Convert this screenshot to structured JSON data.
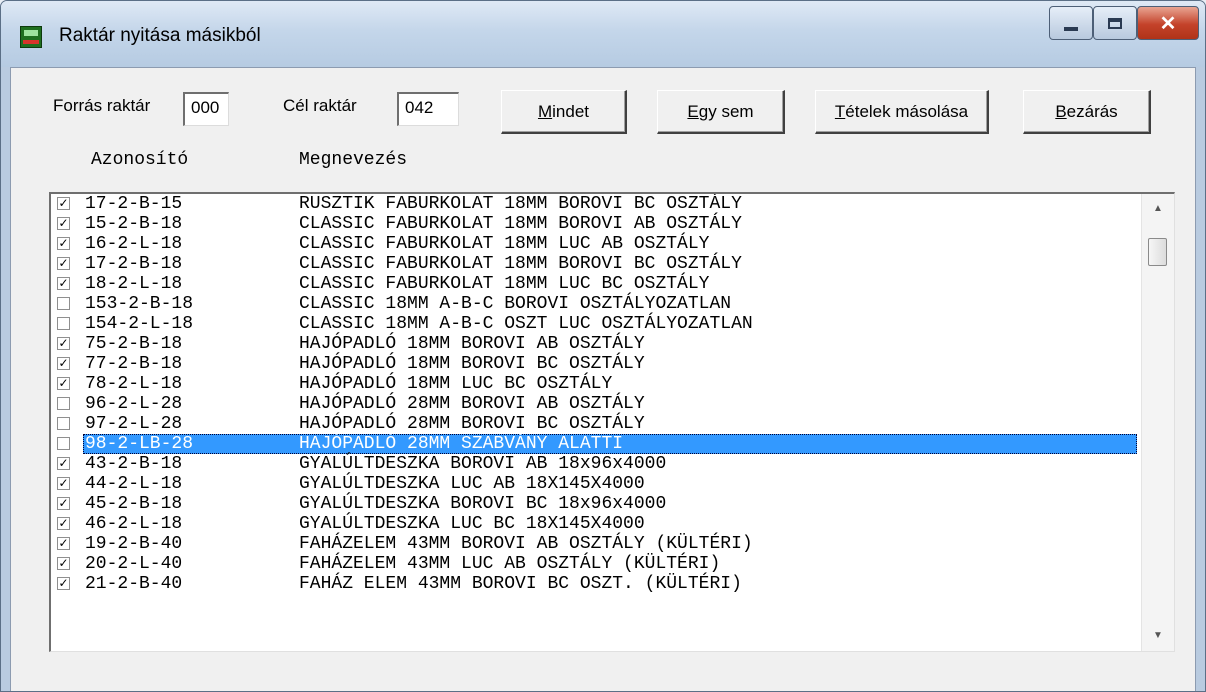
{
  "window": {
    "title": "Raktár nyitása másikból"
  },
  "form": {
    "source_label": "Forrás raktár",
    "source_value": "000",
    "target_label": "Cél raktár",
    "target_value": "042"
  },
  "buttons": {
    "all": {
      "mnemonic": "M",
      "rest": "indet"
    },
    "none": {
      "mnemonic": "E",
      "rest": "gy sem"
    },
    "copy": {
      "mnemonic": "T",
      "rest": "ételek másolása"
    },
    "close": {
      "mnemonic": "B",
      "rest": "ezárás"
    }
  },
  "columns": {
    "id": "Azonosító",
    "name": "Megnevezés"
  },
  "items": [
    {
      "checked": true,
      "id": "17-2-B-15",
      "name": "RUSZTIK FABURKOLAT 18MM BOROVI BC OSZTÁLY"
    },
    {
      "checked": true,
      "id": "15-2-B-18",
      "name": "CLASSIC FABURKOLAT 18MM BOROVI AB OSZTÁLY"
    },
    {
      "checked": true,
      "id": "16-2-L-18",
      "name": "CLASSIC FABURKOLAT 18MM LUC AB OSZTÁLY"
    },
    {
      "checked": true,
      "id": "17-2-B-18",
      "name": "CLASSIC FABURKOLAT 18MM BOROVI BC OSZTÁLY"
    },
    {
      "checked": true,
      "id": "18-2-L-18",
      "name": "CLASSIC FABURKOLAT 18MM LUC BC OSZTÁLY"
    },
    {
      "checked": false,
      "id": "153-2-B-18",
      "name": "CLASSIC 18MM A-B-C BOROVI OSZTÁLYOZATLAN"
    },
    {
      "checked": false,
      "id": "154-2-L-18",
      "name": "CLASSIC 18MM A-B-C OSZT LUC OSZTÁLYOZATLAN"
    },
    {
      "checked": true,
      "id": "75-2-B-18",
      "name": "HAJÓPADLÓ 18MM BOROVI AB OSZTÁLY"
    },
    {
      "checked": true,
      "id": "77-2-B-18",
      "name": "HAJÓPADLÓ 18MM BOROVI BC OSZTÁLY"
    },
    {
      "checked": true,
      "id": "78-2-L-18",
      "name": "HAJÓPADLÓ 18MM LUC BC OSZTÁLY"
    },
    {
      "checked": false,
      "id": "96-2-L-28",
      "name": "HAJÓPADLÓ 28MM BOROVI AB OSZTÁLY"
    },
    {
      "checked": false,
      "id": "97-2-L-28",
      "name": "HAJÓPADLÓ 28MM BOROVI BC OSZTÁLY"
    },
    {
      "checked": false,
      "id": "98-2-LB-28",
      "name": "HAJÓPADLÓ 28MM  SZABVÁNY ALATTI",
      "selected": true
    },
    {
      "checked": true,
      "id": "43-2-B-18",
      "name": "GYALÚLTDESZKA  BOROVI AB 18x96x4000"
    },
    {
      "checked": true,
      "id": "44-2-L-18",
      "name": "GYALÚLTDESZKA  LUC AB 18X145X4000"
    },
    {
      "checked": true,
      "id": "45-2-B-18",
      "name": "GYALÚLTDESZKA  BOROVI BC 18x96x4000"
    },
    {
      "checked": true,
      "id": "46-2-L-18",
      "name": "GYALÚLTDESZKA  LUC BC 18X145X4000"
    },
    {
      "checked": true,
      "id": "19-2-B-40",
      "name": "FAHÁZELEM 43MM BOROVI AB OSZTÁLY (KÜLTÉRI)"
    },
    {
      "checked": true,
      "id": "20-2-L-40",
      "name": "FAHÁZELEM 43MM LUC AB OSZTÁLY (KÜLTÉRI)"
    },
    {
      "checked": true,
      "id": "21-2-B-40",
      "name": "FAHÁZ ELEM 43MM BOROVI BC OSZT. (KÜLTÉRI)"
    }
  ]
}
